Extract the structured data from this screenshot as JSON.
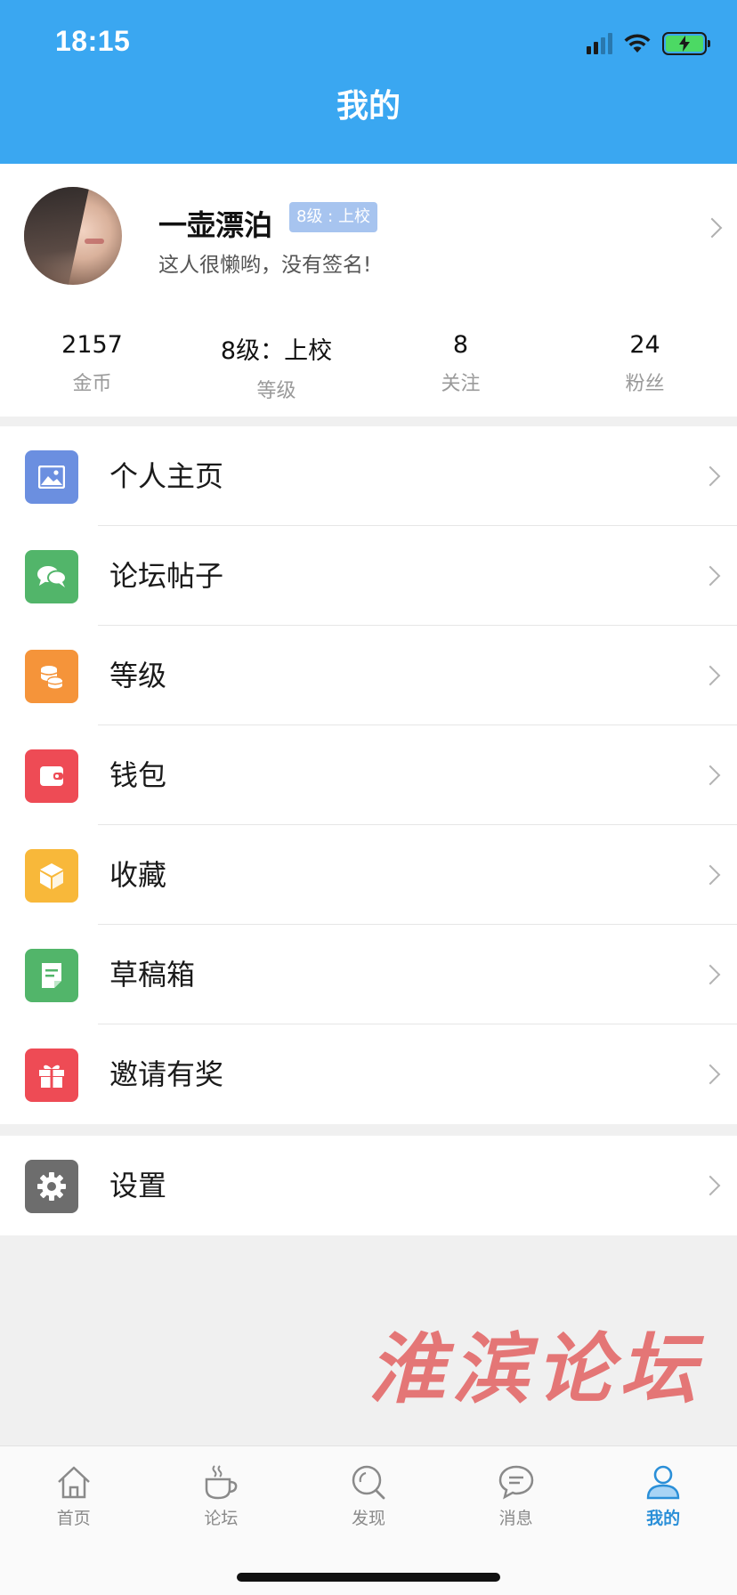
{
  "status_bar": {
    "time": "18:15"
  },
  "header": {
    "title": "我的"
  },
  "profile": {
    "username": "一壶漂泊",
    "level_badge": "8级 : 上校",
    "signature": "这人很懒哟，没有签名!",
    "stats": [
      {
        "value": "2157",
        "label": "金币"
      },
      {
        "value": "8级：上校",
        "label": "等级"
      },
      {
        "value": "8",
        "label": "关注"
      },
      {
        "value": "24",
        "label": "粉丝"
      }
    ]
  },
  "menu": {
    "items": [
      {
        "label": "个人主页",
        "icon": "image-icon",
        "color": "#6b8fe0"
      },
      {
        "label": "论坛帖子",
        "icon": "chat-bubbles-icon",
        "color": "#52b56a"
      },
      {
        "label": "等级",
        "icon": "coins-icon",
        "color": "#f5943a"
      },
      {
        "label": "钱包",
        "icon": "wallet-icon",
        "color": "#ee4b55"
      },
      {
        "label": "收藏",
        "icon": "box-icon",
        "color": "#f8b83a"
      },
      {
        "label": "草稿箱",
        "icon": "note-icon",
        "color": "#52b56a"
      },
      {
        "label": "邀请有奖",
        "icon": "gift-icon",
        "color": "#ee4b55"
      }
    ],
    "settings": {
      "label": "设置",
      "icon": "gear-icon",
      "color": "#6d6d6d"
    }
  },
  "watermark": "淮滨论坛",
  "tabbar": {
    "tabs": [
      {
        "label": "首页",
        "icon": "home-icon"
      },
      {
        "label": "论坛",
        "icon": "coffee-cup-icon"
      },
      {
        "label": "发现",
        "icon": "search-icon"
      },
      {
        "label": "消息",
        "icon": "message-icon"
      },
      {
        "label": "我的",
        "icon": "user-icon",
        "active": true
      }
    ],
    "active_color": "#2a8fd8"
  }
}
